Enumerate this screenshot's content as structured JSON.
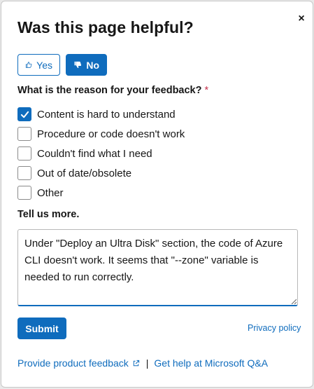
{
  "dialog": {
    "title": "Was this page helpful?",
    "close_glyph": "×",
    "vote": {
      "yes_label": "Yes",
      "no_label": "No",
      "selected": "No",
      "yes_icon": "thumbs-up-outline-icon",
      "no_icon": "thumbs-down-filled-icon"
    },
    "question": "What is the reason for your feedback?",
    "required_marker": "*",
    "options": [
      {
        "label": "Content is hard to understand",
        "checked": true
      },
      {
        "label": "Procedure or code doesn't work",
        "checked": false
      },
      {
        "label": "Couldn't find what I need",
        "checked": false
      },
      {
        "label": "Out of date/obsolete",
        "checked": false
      },
      {
        "label": "Other",
        "checked": false
      }
    ],
    "tell_more_label": "Tell us more.",
    "comment_value": "Under \"Deploy an Ultra Disk\" section, the code of Azure CLI doesn't work. It seems that \"--zone\" variable is needed to run correctly.",
    "submit_label": "Submit",
    "privacy_label": "Privacy policy",
    "footer": {
      "product_feedback_label": "Provide product feedback",
      "separator": "|",
      "help_label": "Get help at Microsoft Q&A"
    }
  },
  "colors": {
    "accent": "#0f6cbd",
    "required": "#c4314b",
    "text": "#161616"
  }
}
